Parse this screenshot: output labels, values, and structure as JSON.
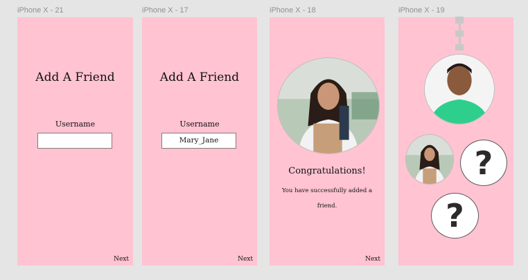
{
  "frames": [
    {
      "label": "iPhone X - 21",
      "title": "Add A Friend",
      "field_label": "Username",
      "field_value": "",
      "next": "Next"
    },
    {
      "label": "iPhone X - 17",
      "title": "Add A Friend",
      "field_label": "Username",
      "field_value": "Mary_Jane",
      "next": "Next"
    },
    {
      "label": "iPhone X - 18",
      "congrats": "Congratulations!",
      "message": "You have successfully added a friend.",
      "next": "Next"
    },
    {
      "label": "iPhone X - 19",
      "unknown_1": "?",
      "unknown_2": "?"
    }
  ],
  "colors": {
    "canvas": "#e5e5e5",
    "frame": "#ffc3d2",
    "label": "#8f8f8f"
  }
}
